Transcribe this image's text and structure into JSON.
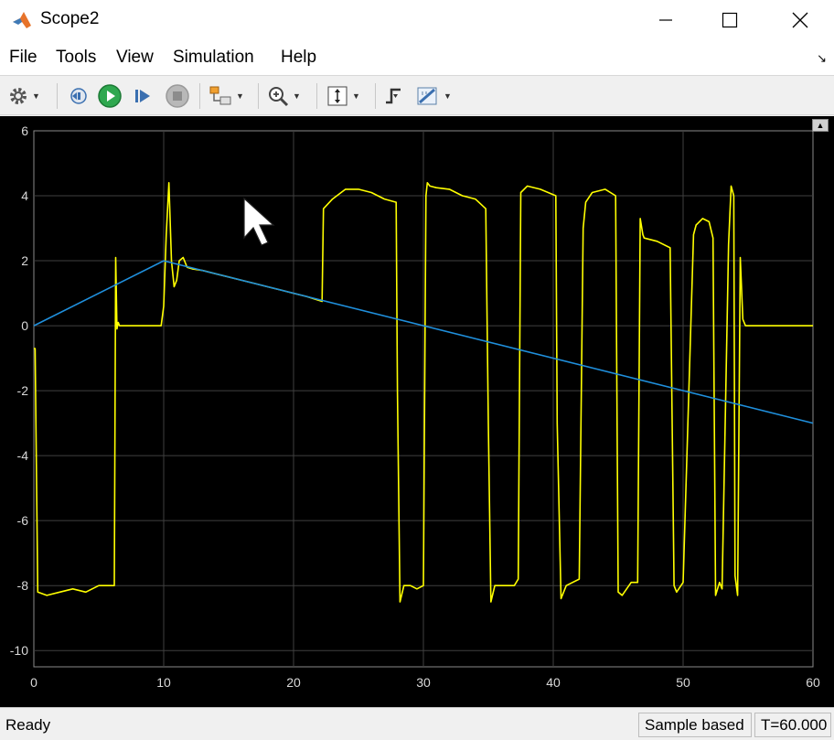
{
  "window": {
    "title": "Scope2"
  },
  "menu": [
    "File",
    "Tools",
    "View",
    "Simulation",
    "Help"
  ],
  "toolbar": {
    "buttons": [
      "settings-icon",
      "step-back-icon",
      "run-icon",
      "step-forward-icon",
      "stop-icon",
      "highlight-block-icon",
      "zoom-icon",
      "scale-axes-icon",
      "triggers-icon",
      "measurements-icon"
    ]
  },
  "status": {
    "left": "Ready",
    "mode": "Sample based",
    "time": "T=60.000"
  },
  "colors": {
    "background": "#000000",
    "grid": "#404040",
    "series1": "#ffff00",
    "series2": "#1f8fdc"
  },
  "chart_data": {
    "type": "line",
    "title": "",
    "xlabel": "",
    "ylabel": "",
    "xlim": [
      0,
      60
    ],
    "ylim": [
      -10.5,
      6
    ],
    "xticks": [
      0,
      10,
      20,
      30,
      40,
      50,
      60
    ],
    "yticks": [
      6,
      4,
      2,
      0,
      -2,
      -4,
      -6,
      -8,
      -10
    ],
    "grid": true,
    "series": [
      {
        "color": "#ffff00",
        "x": [
          0,
          0.1,
          0.3,
          1,
          2,
          3,
          4,
          5,
          6.2,
          6.3,
          6.4,
          6.5,
          6.6,
          7,
          8,
          9,
          9.8,
          10,
          10.2,
          10.4,
          10.6,
          10.8,
          11,
          11.2,
          11.5,
          11.8,
          12.2,
          13,
          14,
          15,
          16,
          17,
          18,
          19,
          20,
          21,
          22.2,
          22.3,
          23,
          24,
          25,
          26,
          27,
          27.9,
          28.0,
          28.2,
          28.5,
          29,
          29.5,
          30,
          30.2,
          30.3,
          30.5,
          31,
          32,
          33,
          34,
          34.8,
          35.0,
          35.2,
          35.5,
          36,
          37,
          37.3,
          37.5,
          38,
          39,
          40.2,
          40.3,
          40.6,
          41,
          42,
          42.3,
          42.5,
          43,
          44,
          44.8,
          45.0,
          45.3,
          46,
          46.5,
          46.7,
          46.9,
          47,
          48,
          49,
          49.3,
          49.5,
          50,
          50.8,
          51,
          51.5,
          52,
          52.3,
          52.5,
          52.8,
          53,
          53.5,
          53.7,
          53.9,
          54.0,
          54.2,
          54.4,
          54.6,
          54.8,
          55.0,
          55.5,
          56,
          58,
          60
        ],
        "y": [
          -0.7,
          -0.7,
          -8.2,
          -8.3,
          -8.2,
          -8.1,
          -8.2,
          -8.0,
          -8.0,
          2.1,
          -0.1,
          0.1,
          0.0,
          0.0,
          0.0,
          0.0,
          0.0,
          0.6,
          2.8,
          4.4,
          2.0,
          1.2,
          1.4,
          2.0,
          2.1,
          1.8,
          1.75,
          1.7,
          1.6,
          1.5,
          1.4,
          1.3,
          1.2,
          1.1,
          1.0,
          0.9,
          0.75,
          3.6,
          3.9,
          4.2,
          4.2,
          4.1,
          3.9,
          3.8,
          -2.0,
          -8.5,
          -8.0,
          -8.0,
          -8.1,
          -8.0,
          4.0,
          4.4,
          4.3,
          4.25,
          4.2,
          4.0,
          3.9,
          3.6,
          -3.0,
          -8.5,
          -8.0,
          -8.0,
          -8.0,
          -7.8,
          4.1,
          4.3,
          4.2,
          4.0,
          -3.0,
          -8.4,
          -8.0,
          -7.8,
          3.0,
          3.8,
          4.1,
          4.2,
          4.0,
          -8.2,
          -8.3,
          -7.9,
          -7.9,
          3.3,
          2.8,
          2.7,
          2.6,
          2.4,
          -8.0,
          -8.2,
          -7.9,
          2.8,
          3.1,
          3.3,
          3.2,
          2.7,
          -8.3,
          -7.9,
          -8.1,
          2.5,
          4.3,
          4.0,
          -7.7,
          -8.3,
          2.1,
          0.2,
          0.0,
          0.0,
          0.0,
          0.0,
          0.0,
          0.0
        ]
      },
      {
        "color": "#1f8fdc",
        "x": [
          0,
          10,
          60
        ],
        "y": [
          0,
          2,
          -3
        ]
      }
    ]
  }
}
